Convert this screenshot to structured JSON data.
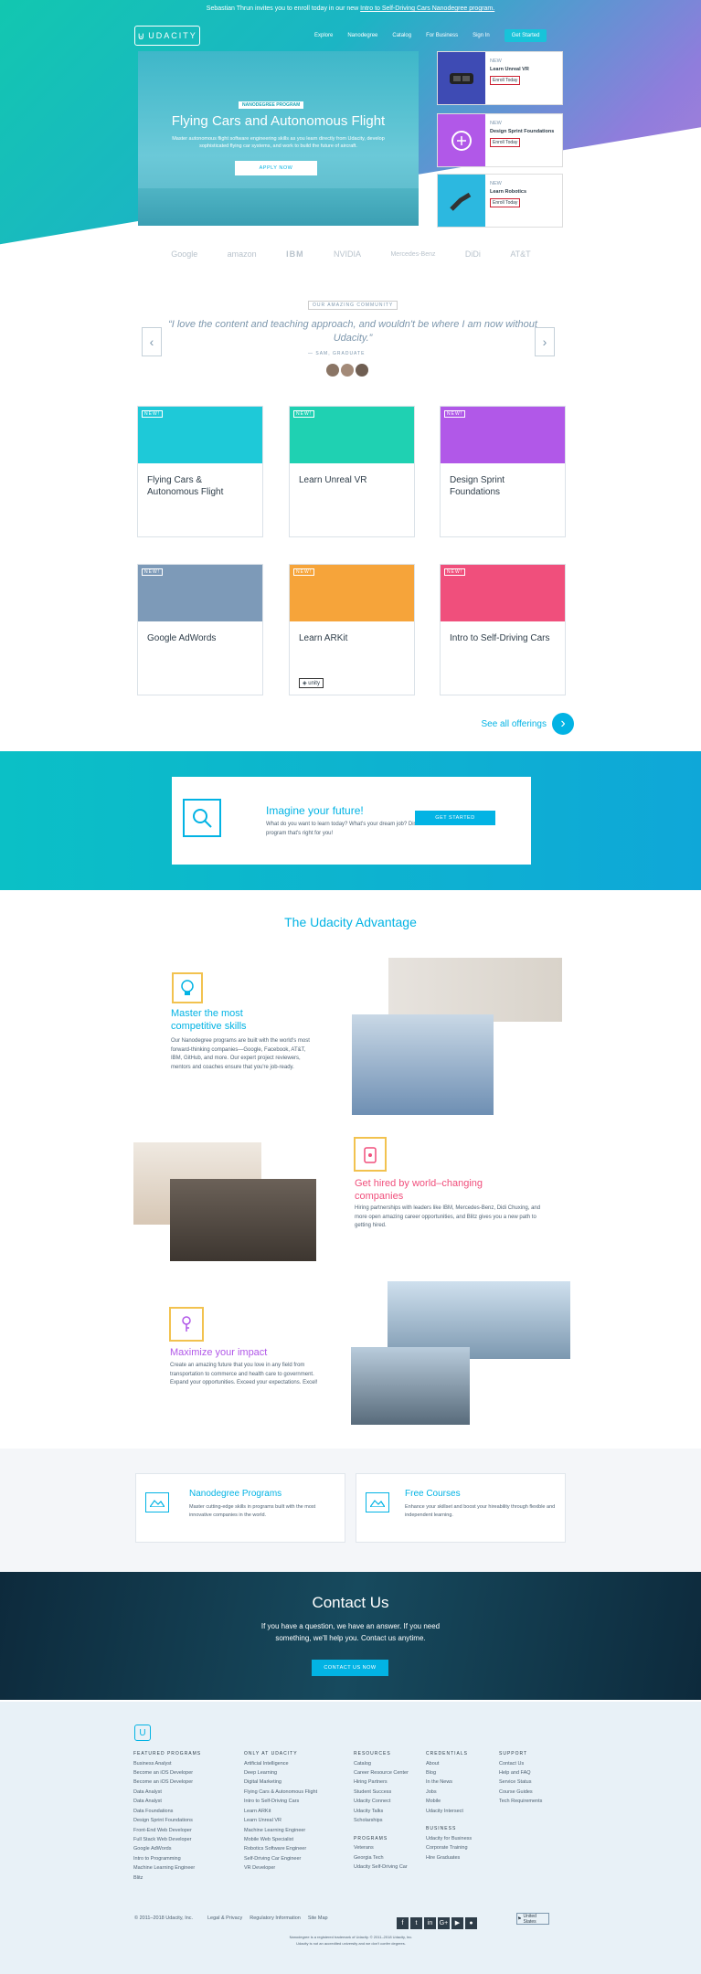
{
  "notice": {
    "prefix": "Sebastian Thrun invites you to enroll today in our new ",
    "link": "Intro to Self-Driving Cars Nanodegree program."
  },
  "logo": {
    "text": "UDACITY"
  },
  "nav": {
    "items": [
      "Explore",
      "Nanodegree",
      "Catalog",
      "For Business",
      "Sign In"
    ],
    "cta": "Get Started"
  },
  "hero": {
    "badge": "NANODEGREE PROGRAM",
    "title": "Flying Cars and Autonomous Flight",
    "paragraph": "Master autonomous flight software engineering skills as you learn directly from Udacity, develop sophisticated flying car systems, and work to build the future of aircraft.",
    "apply": "APPLY NOW"
  },
  "side_content": [
    {
      "tag": "NEW",
      "title": "Learn Unreal VR",
      "pill": "Enroll Today",
      "icon": "vr-headset-icon"
    },
    {
      "tag": "NEW",
      "title": "Design Sprint Foundations",
      "pill": "Enroll Today",
      "icon": "brain-icon"
    },
    {
      "tag": "NEW",
      "title": "Learn Robotics",
      "pill": "Enroll Today",
      "icon": "robot-arm-icon"
    }
  ],
  "cooperation": [
    "Google",
    "amazon",
    "IBM",
    "NVIDIA",
    "Mercedes-Benz",
    "DiDi",
    "AT&T"
  ],
  "reviews": {
    "label": "OUR AMAZING COMMUNITY",
    "quote": "“I love the content and teaching approach, and wouldn't be where I am now without Udacity.”",
    "whose": "— SAM, GRADUATE",
    "prev": "‹",
    "next": "›"
  },
  "cards": [
    {
      "new": "NEW!",
      "title": "Flying Cars & Autonomous Flight",
      "color": "#1ec9d8"
    },
    {
      "new": "NEW!",
      "title": "Learn Unreal VR",
      "color": "#1fd1b2"
    },
    {
      "new": "NEW!",
      "title": "Design Sprint Foundations",
      "color": "#b158e8"
    },
    {
      "new": "NEW!",
      "title": "Google AdWords",
      "color": "#7d9ab8"
    },
    {
      "new": "NEW!",
      "title": "Learn ARKit",
      "color": "#f6a43a"
    },
    {
      "new": "NEW!",
      "title": "Intro to Self-Driving Cars",
      "color": "#f04f7c"
    }
  ],
  "tech_logo": "unity",
  "see_all": {
    "label": "See all offerings",
    "button": "›"
  },
  "discover": {
    "title": "Imagine your future!",
    "paragraph": "What do you want to learn today? What's your dream job? Discover the program that's right for you!",
    "button": "GET STARTED"
  },
  "advantages": {
    "title": "The Udacity Advantage",
    "items": [
      {
        "title": "Master the most competitive skills",
        "paragraph": "Our Nanodegree programs are built with the world's most forward-thinking companies—Google, Facebook, AT&T, IBM, GitHub, and more. Our expert project reviewers, mentors and coaches ensure that you're job-ready."
      },
      {
        "title": "Get hired by world–changing companies",
        "paragraph": "Hiring partnerships with leaders like IBM, Mercedes-Benz, Didi Chuxing, and more open amazing career opportunities, and Blitz gives you a new path to getting hired."
      },
      {
        "title": "Maximize your impact",
        "paragraph": "Create an amazing future that you love in any field from transportation to commerce and health care to government. Expand your opportunities. Exceed your expectations. Excel!"
      }
    ],
    "offerings": [
      {
        "title": "Nanodegree Programs",
        "paragraph": "Master cutting-edge skills in programs built with the most innovative companies in the world."
      },
      {
        "title": "Free Courses",
        "paragraph": "Enhance your skillset and boost your hireability through flexible and independent learning."
      }
    ]
  },
  "contact": {
    "title": "Contact Us",
    "paragraph": "If you have a question, we have an answer. If you need something, we'll help you. Contact us anytime.",
    "button": "CONTACT US NOW"
  },
  "footer": {
    "columns": [
      {
        "heading": "FEATURED PROGRAMS",
        "links": [
          "Business Analyst",
          "Become an iOS Developer",
          "Become an iOS Developer",
          "Data Analyst",
          "Data Analyst",
          "Data Foundations",
          "Design Sprint Foundations",
          "Front-End Web Developer",
          "Full Stack Web Developer",
          "Google AdWords",
          "Intro to Programming",
          "Machine Learning Engineer",
          "Blitz"
        ]
      },
      {
        "heading": "ONLY AT UDACITY",
        "links": [
          "Artificial Intelligence",
          "Deep Learning",
          "Digital Marketing",
          "Flying Cars & Autonomous Flight",
          "Intro to Self-Driving Cars",
          "Learn ARKit",
          "Learn Unreal VR",
          "Machine Learning Engineer",
          "Mobile Web Specialist",
          "Robotics Software Engineer",
          "Self-Driving Car Engineer",
          "VR Developer"
        ]
      },
      {
        "heading": "RESOURCES",
        "links": [
          "Catalog",
          "Career Resource Center",
          "Hiring Partners",
          "Student Success",
          "Udacity Connect",
          "Udacity Talks",
          "Scholarships"
        ]
      },
      {
        "heading": "PROGRAMS",
        "links": [
          "Veterans",
          "Georgia Tech",
          "Udacity Self-Driving Car"
        ]
      },
      {
        "heading": "CREDENTIALS",
        "links": [
          "About",
          "Blog",
          "In the News",
          "Jobs",
          "Mobile",
          "Udacity Intersect"
        ]
      },
      {
        "heading": "BUSINESS",
        "links": [
          "Udacity for Business",
          "Corporate Training",
          "Hire Graduates"
        ]
      },
      {
        "heading": "SUPPORT",
        "links": [
          "Contact Us",
          "Help and FAQ",
          "Service Status",
          "Course Guides",
          "Tech Requirements"
        ]
      }
    ],
    "copyright": "© 2011–2018 Udacity, Inc.",
    "links": [
      "Legal & Privacy",
      "Regulatory Information",
      "Site Map"
    ],
    "social": [
      "f",
      "t",
      "in",
      "G+",
      "▶",
      "●"
    ],
    "country": "United States",
    "licenses": "Nanodegree is a registered trademark of Udacity. © 2011–2018 Udacity, Inc. Udacity is not an accredited university and we don't confer degrees."
  }
}
